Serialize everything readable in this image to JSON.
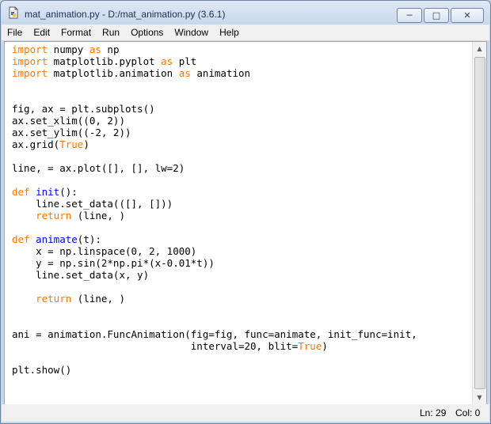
{
  "window": {
    "title": "mat_animation.py - D:/mat_animation.py (3.6.1)",
    "controls": {
      "minimize": "─",
      "maximize": "□",
      "close": "✕"
    }
  },
  "menu": [
    "File",
    "Edit",
    "Format",
    "Run",
    "Options",
    "Window",
    "Help"
  ],
  "code_lines": [
    [
      {
        "t": "import",
        "c": "kw"
      },
      {
        "t": " numpy "
      },
      {
        "t": "as",
        "c": "kw"
      },
      {
        "t": " np"
      }
    ],
    [
      {
        "t": "import",
        "c": "kw"
      },
      {
        "t": " matplotlib.pyplot "
      },
      {
        "t": "as",
        "c": "kw"
      },
      {
        "t": " plt"
      }
    ],
    [
      {
        "t": "import",
        "c": "kw"
      },
      {
        "t": " matplotlib.animation "
      },
      {
        "t": "as",
        "c": "kw"
      },
      {
        "t": " animation"
      }
    ],
    [],
    [],
    [
      {
        "t": "fig, ax = plt.subplots()"
      }
    ],
    [
      {
        "t": "ax.set_xlim((0, 2))"
      }
    ],
    [
      {
        "t": "ax.set_ylim((-2, 2))"
      }
    ],
    [
      {
        "t": "ax.grid("
      },
      {
        "t": "True",
        "c": "kw"
      },
      {
        "t": ")"
      }
    ],
    [],
    [
      {
        "t": "line, = ax.plot([], [], lw=2)"
      }
    ],
    [],
    [
      {
        "t": "def",
        "c": "kw"
      },
      {
        "t": " "
      },
      {
        "t": "init",
        "c": "def-name"
      },
      {
        "t": "():"
      }
    ],
    [
      {
        "t": "    line.set_data(([], []))"
      }
    ],
    [
      {
        "t": "    "
      },
      {
        "t": "return",
        "c": "kw"
      },
      {
        "t": " (line, )"
      }
    ],
    [],
    [
      {
        "t": "def",
        "c": "kw"
      },
      {
        "t": " "
      },
      {
        "t": "animate",
        "c": "def-name"
      },
      {
        "t": "(t):"
      }
    ],
    [
      {
        "t": "    x = np.linspace(0, 2, 1000)"
      }
    ],
    [
      {
        "t": "    y = np.sin(2*np.pi*(x-0.01*t))"
      }
    ],
    [
      {
        "t": "    line.set_data(x, y)"
      }
    ],
    [],
    [
      {
        "t": "    "
      },
      {
        "t": "return",
        "c": "kw"
      },
      {
        "t": " (line, )"
      }
    ],
    [],
    [],
    [
      {
        "t": "ani = animation.FuncAnimation(fig=fig, func=animate, init_func=init,"
      }
    ],
    [
      {
        "t": "                              interval=20, blit="
      },
      {
        "t": "True",
        "c": "kw"
      },
      {
        "t": ")"
      }
    ],
    [],
    [
      {
        "t": "plt.show()"
      }
    ]
  ],
  "status": {
    "line": "Ln: 29",
    "col": "Col: 0"
  },
  "scrollbar": {
    "up": "▲",
    "down": "▼"
  },
  "colors": {
    "keyword": "#ff7700",
    "def_name": "#0000ff"
  }
}
